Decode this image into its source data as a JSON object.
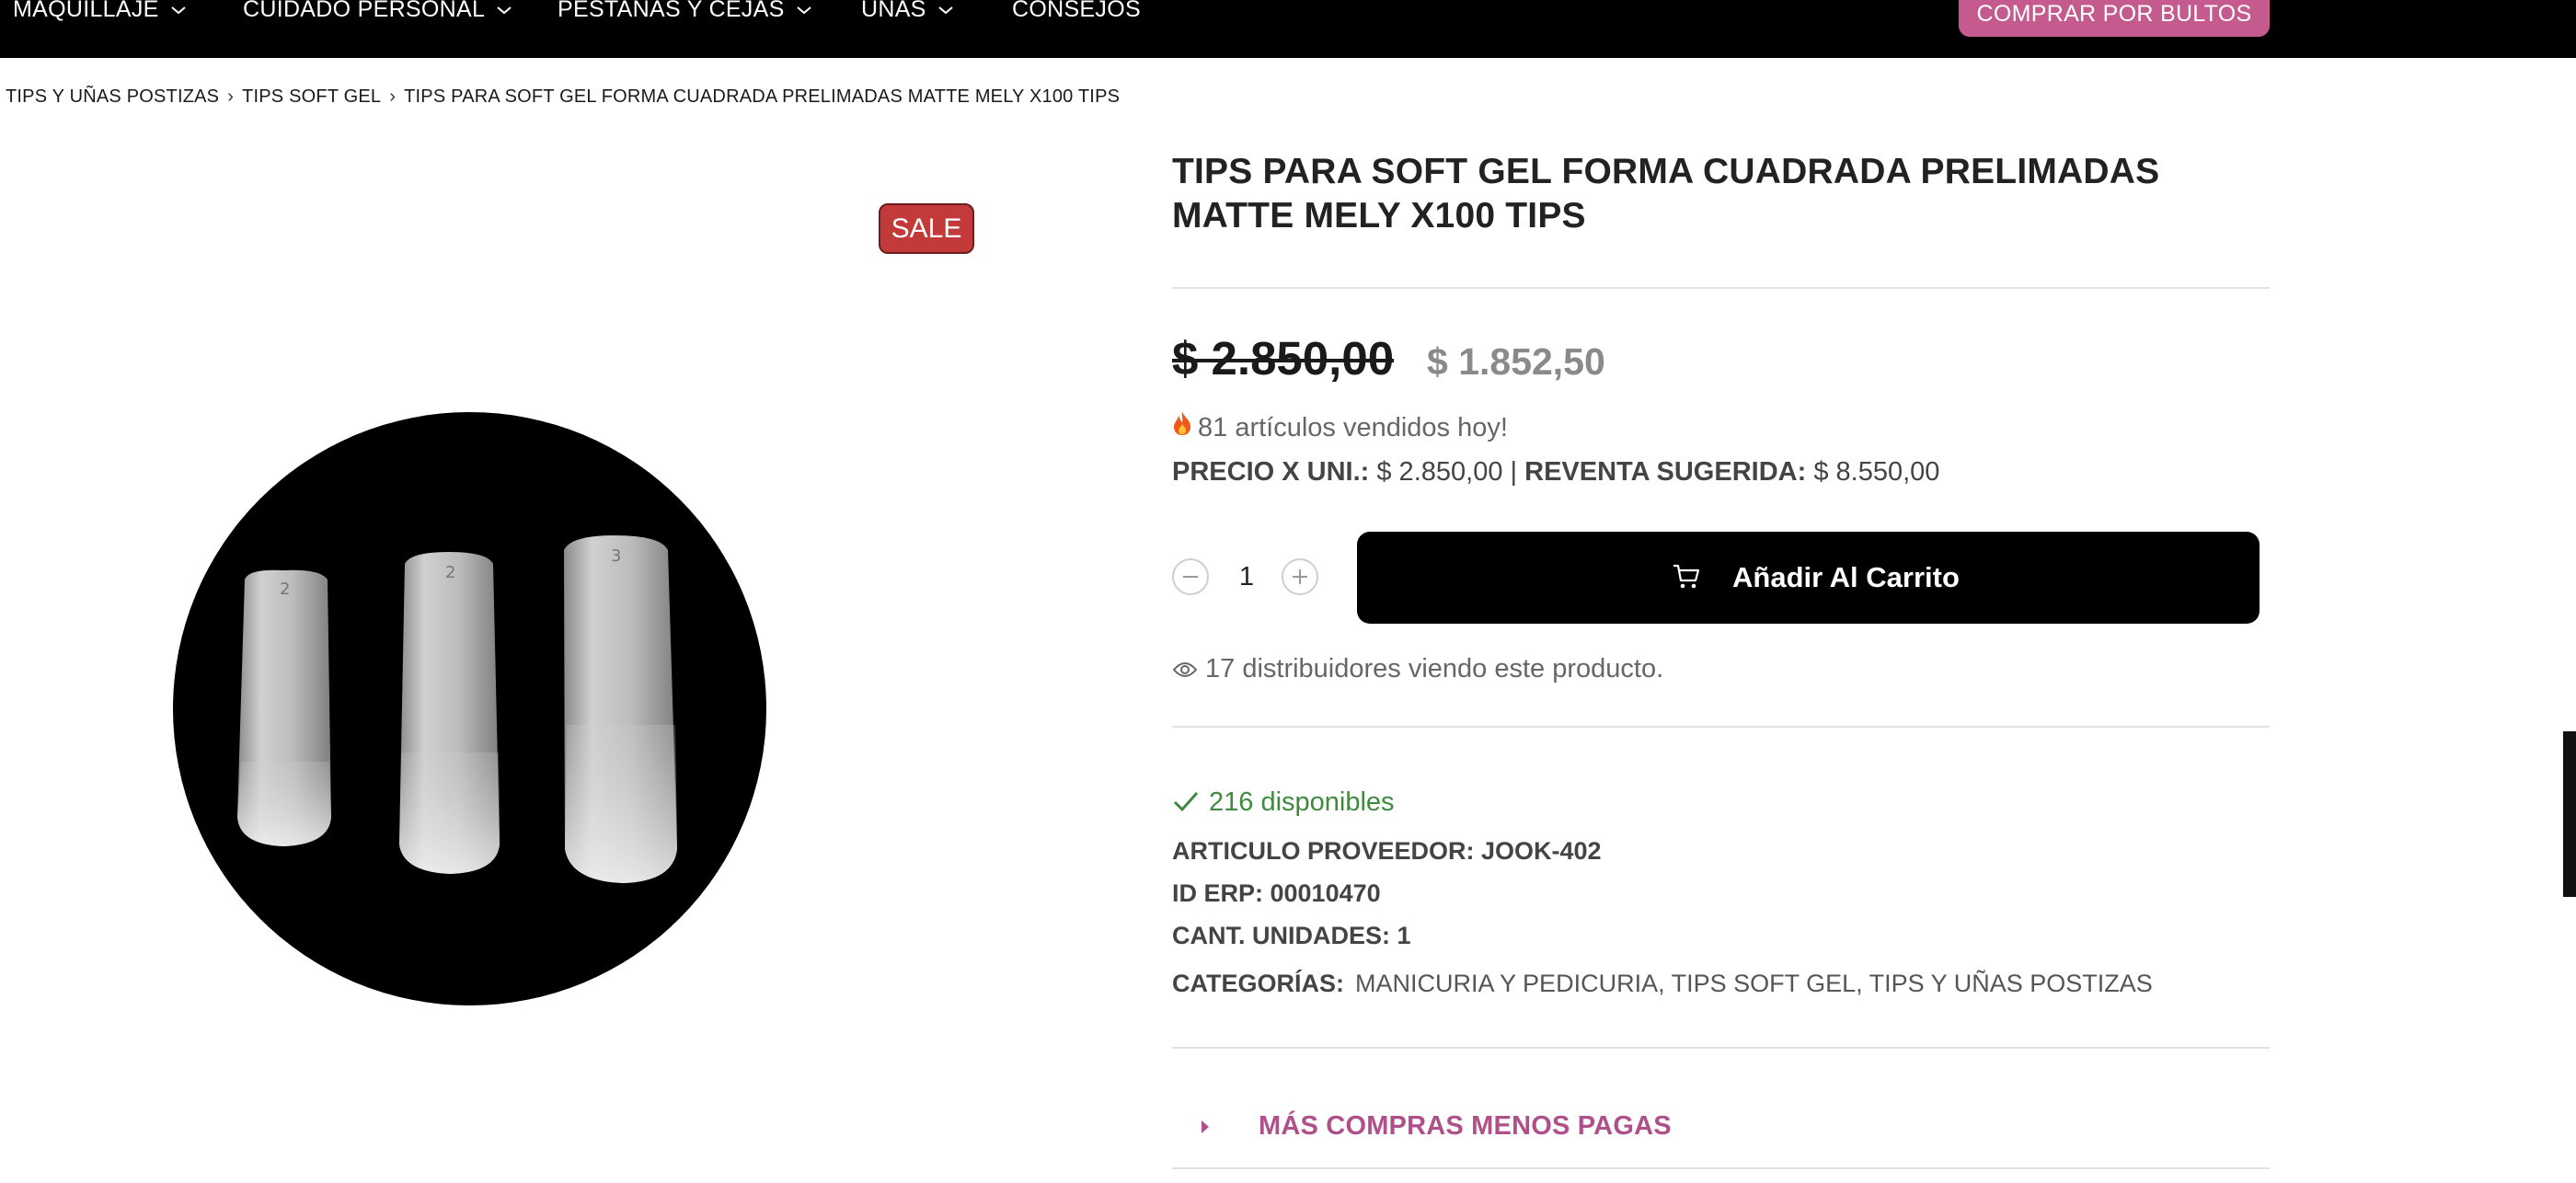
{
  "nav": {
    "items": [
      {
        "label": "MAQUILLAJE",
        "has_dropdown": true
      },
      {
        "label": "CUIDADO PERSONAL",
        "has_dropdown": true
      },
      {
        "label": "PESTAÑAS Y CEJAS",
        "has_dropdown": true
      },
      {
        "label": "UÑAS",
        "has_dropdown": true
      },
      {
        "label": "CONSEJOS",
        "has_dropdown": false
      }
    ],
    "bulk_button": "COMPRAR POR BULTOS"
  },
  "breadcrumb": [
    "TIPS Y UÑAS POSTIZAS",
    "TIPS SOFT GEL",
    "TIPS PARA SOFT GEL FORMA CUADRADA PRELIMADAS MATTE MELY X100 TIPS"
  ],
  "product": {
    "sale_badge": "SALE",
    "title": "TIPS PARA SOFT GEL FORMA CUADRADA PRELIMADAS MATTE MELY X100 TIPS",
    "price_old": "$ 2.850,00",
    "price_new": "$ 1.852,50",
    "sold_today": "81 artículos vendidos hoy!",
    "unit_price_label": "PRECIO X UNI.:",
    "unit_price_value": "$ 2.850,00",
    "divider": "|",
    "resale_label": "REVENTA SUGERIDA:",
    "resale_value": "$ 8.550,00",
    "quantity": "1",
    "add_to_cart": "Añadir Al Carrito",
    "viewers": "17 distribuidores viendo este producto.",
    "stock": "216 disponibles",
    "supplier_article": "ARTICULO PROVEEDOR: JOOK-402",
    "erp_id": "ID ERP: 00010470",
    "units": "CANT. UNIDADES: 1",
    "categories_label": "CATEGORÍAS:",
    "categories": "MANICURIA Y PEDICURIA, TIPS SOFT GEL, TIPS Y UÑAS POSTIZAS",
    "accordion_title": "MÁS COMPRAS MENOS PAGAS"
  },
  "colors": {
    "nav_bg": "#000000",
    "bulk_button_bg": "#c45a8e",
    "sale_badge_bg": "#c23a3a",
    "stock_green": "#3f8a3f",
    "accent_pink": "#b0508a"
  },
  "icons": [
    "chevron-down-icon",
    "fire-icon",
    "minus-icon",
    "plus-icon",
    "cart-icon",
    "eye-icon",
    "check-icon",
    "caret-right-icon"
  ]
}
